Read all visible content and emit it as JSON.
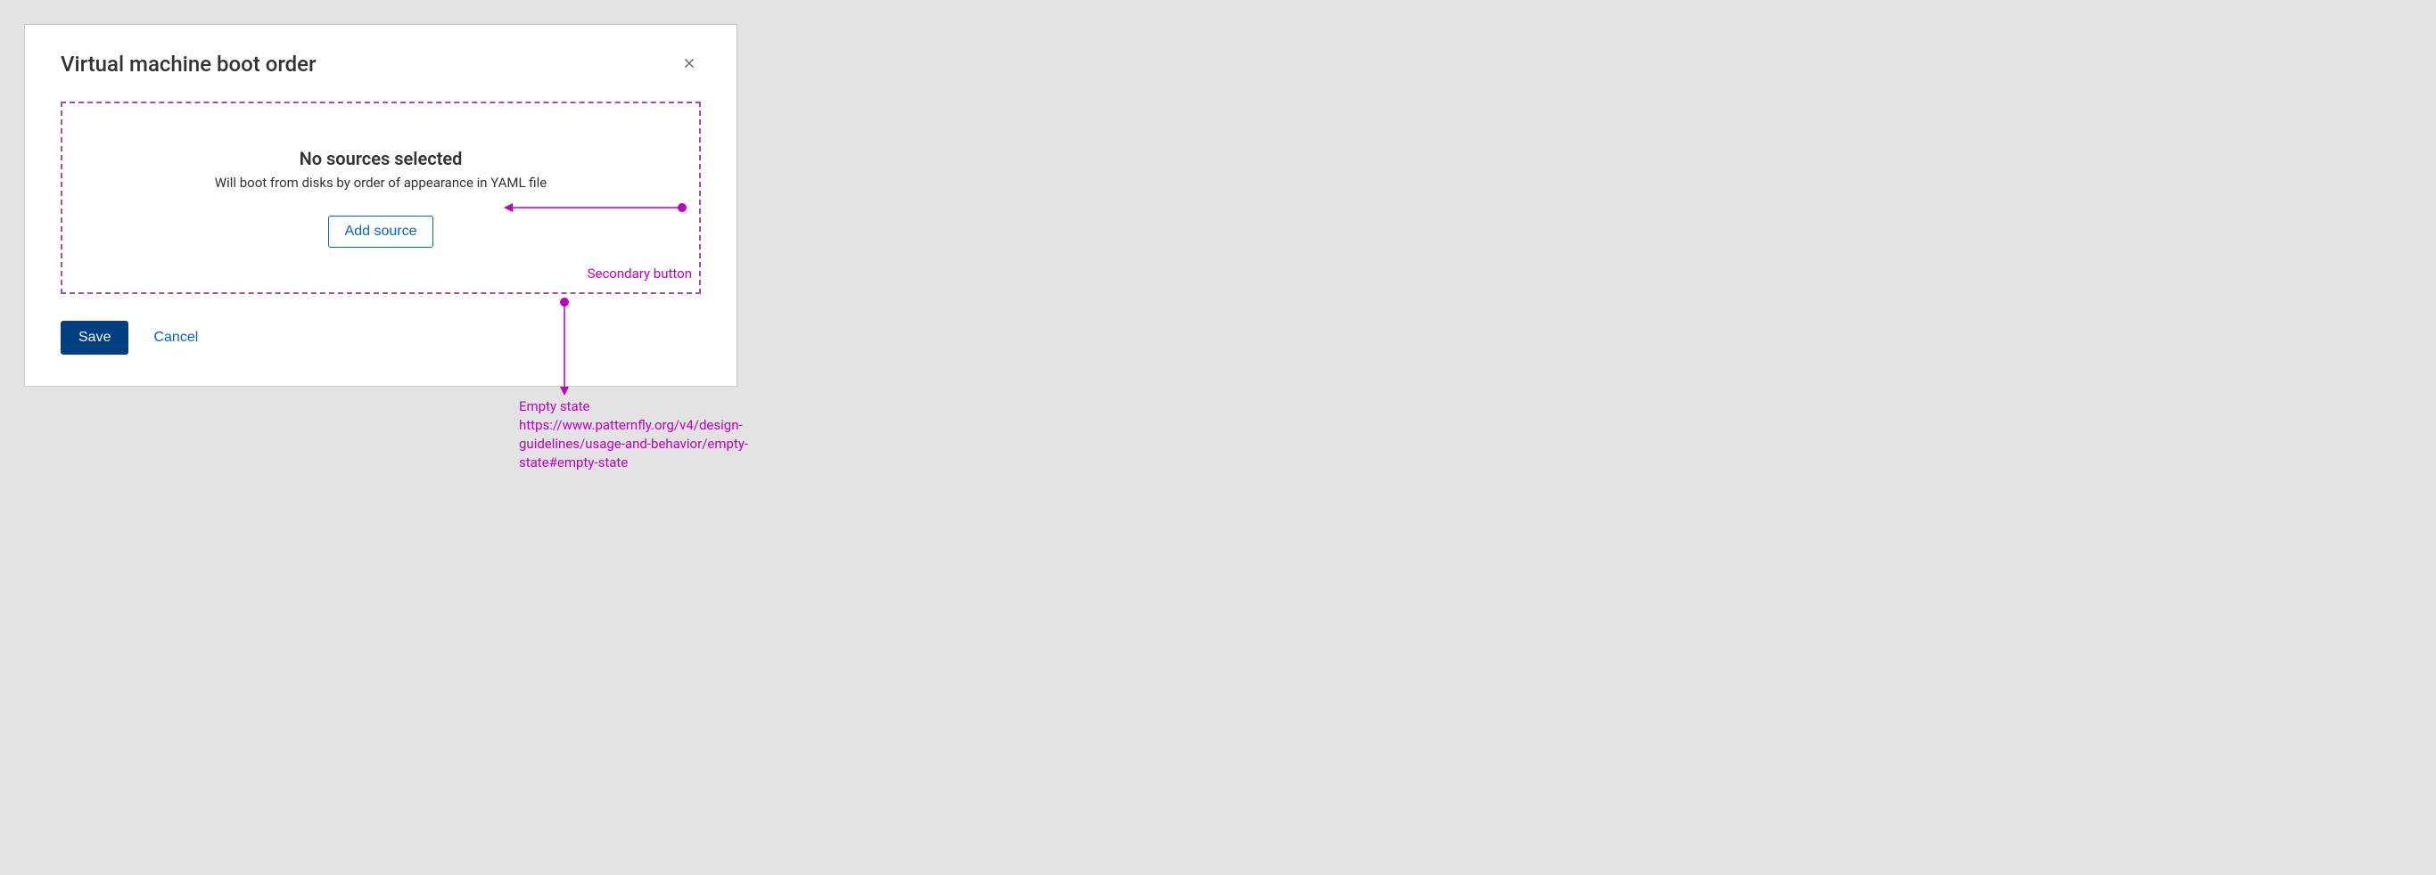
{
  "modal": {
    "title": "Virtual machine boot order",
    "emptyState": {
      "title": "No sources selected",
      "description": "Will boot from disks by order of appearance in YAML file",
      "actionLabel": "Add source"
    },
    "footer": {
      "saveLabel": "Save",
      "cancelLabel": "Cancel"
    }
  },
  "annotations": {
    "secondaryButton": "Secondary button",
    "emptyStateTitle": "Empty state",
    "emptyStateLink1": "https://www.patternfly.org/v4/design-",
    "emptyStateLink2": "guidelines/usage-and-behavior/empty-",
    "emptyStateLink3": "state#empty-state"
  }
}
